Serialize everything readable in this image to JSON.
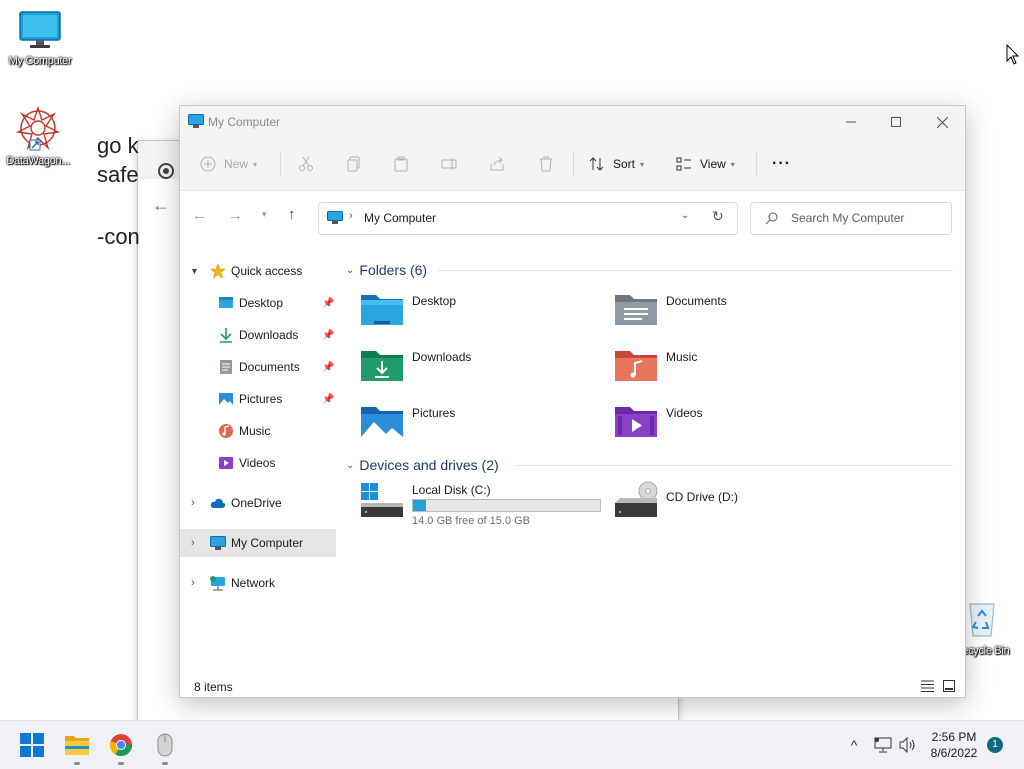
{
  "desktop": {
    "icons": [
      {
        "label": "My Computer"
      },
      {
        "label": "DataWagon..."
      },
      {
        "label": "Recycle Bin"
      }
    ]
  },
  "background_window": {
    "text_lines": [
      "go k",
      "safe",
      "-con"
    ]
  },
  "explorer": {
    "title": "My Computer",
    "toolbar": {
      "new_label": "New",
      "sort_label": "Sort",
      "view_label": "View",
      "more_label": "···"
    },
    "address": {
      "path": "My Computer"
    },
    "search": {
      "placeholder": "Search My Computer"
    },
    "sidebar": {
      "quick_access": "Quick access",
      "items": [
        {
          "label": "Desktop",
          "pinned": true
        },
        {
          "label": "Downloads",
          "pinned": true
        },
        {
          "label": "Documents",
          "pinned": true
        },
        {
          "label": "Pictures",
          "pinned": true
        },
        {
          "label": "Music",
          "pinned": false
        },
        {
          "label": "Videos",
          "pinned": false
        }
      ],
      "onedrive": "OneDrive",
      "my_computer": "My Computer",
      "network": "Network"
    },
    "folders_header": "Folders (6)",
    "folders": [
      {
        "label": "Desktop"
      },
      {
        "label": "Documents"
      },
      {
        "label": "Downloads"
      },
      {
        "label": "Music"
      },
      {
        "label": "Pictures"
      },
      {
        "label": "Videos"
      }
    ],
    "devices_header": "Devices and drives (2)",
    "drives": [
      {
        "label": "Local Disk (C:)",
        "free_text": "14.0 GB free of 15.0 GB",
        "used_fraction": 0.067
      },
      {
        "label": "CD Drive (D:)"
      }
    ],
    "status": {
      "items_count": "8 items"
    },
    "colors": {
      "accent": "#26a0da",
      "group_header": "#1e3a6e",
      "selected_bg": "#e5e5e5"
    }
  },
  "taskbar": {
    "time": "2:56 PM",
    "date": "8/6/2022",
    "notification_count": "1"
  }
}
